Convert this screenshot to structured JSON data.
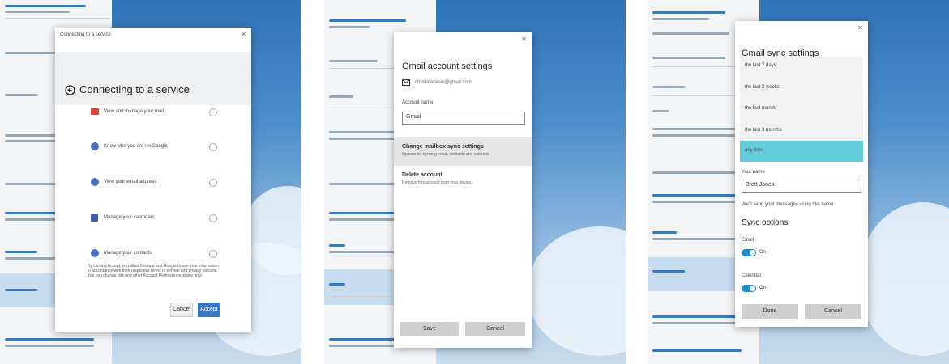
{
  "panel1": {
    "dialog_title": "Connecting to a service",
    "heading": "Connecting to a service",
    "permissions": [
      {
        "label": "View and manage your mail"
      },
      {
        "label": "Know who you are on Google"
      },
      {
        "label": "View your email address"
      },
      {
        "label": "Manage your calendars"
      },
      {
        "label": "Manage your contacts"
      }
    ],
    "disclaimer": "By clicking Accept, you allow this app and Google to use your information in accordance with their respective terms of service and privacy policies. You can change this and other Account Permissions at any time.",
    "cancel_label": "Cancel",
    "accept_label": "Accept"
  },
  "panel2": {
    "heading": "Gmail account settings",
    "email": "christinenesw@gmail.com",
    "account_name_label": "Account name",
    "account_name_value": "Gmail",
    "sync_title": "Change mailbox sync settings",
    "sync_sub": "Options for syncing email, contacts and calendar.",
    "delete_title": "Delete account",
    "delete_sub": "Remove this account from your device.",
    "save_label": "Save",
    "cancel_label": "Cancel"
  },
  "panel3": {
    "heading": "Gmail sync settings",
    "options": [
      "the last 7 days",
      "the last 2 weeks",
      "the last month",
      "the last 3 months",
      "any time"
    ],
    "selected_index": 4,
    "your_name_label": "Your name",
    "your_name_value": "Brett Jones",
    "your_name_hint": "We'll send your messages using this name.",
    "sync_options_title": "Sync options",
    "email_label": "Email",
    "email_state": "On",
    "calendar_label": "Calendar",
    "calendar_state": "On",
    "done_label": "Done",
    "cancel_label": "Cancel"
  },
  "colors": {
    "accent": "#3a78c2",
    "selected": "#64cddc",
    "toggle": "#1a8ed1"
  }
}
